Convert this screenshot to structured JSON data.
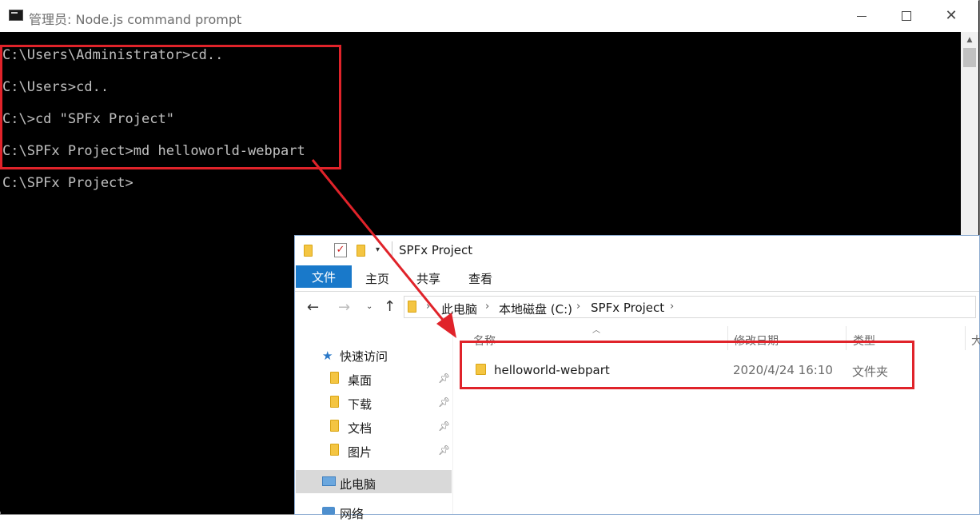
{
  "cmd": {
    "title": "管理员: Node.js command prompt",
    "lines": [
      "C:\\Users\\Administrator>cd..",
      "C:\\Users>cd..",
      "C:\\>cd \"SPFx Project\"",
      "C:\\SPFx Project>md helloworld-webpart",
      "C:\\SPFx Project>"
    ],
    "controls": {
      "minimize": "minimize-icon",
      "maximize": "maximize-icon",
      "close": "close-icon"
    }
  },
  "explorer": {
    "title": "SPFx Project",
    "ribbon_tabs": [
      "文件",
      "主页",
      "共享",
      "查看"
    ],
    "breadcrumb": [
      "此电脑",
      "本地磁盘 (C:)",
      "SPFx Project"
    ],
    "nav": {
      "quick_access": "快速访问",
      "items": [
        "桌面",
        "下载",
        "文档",
        "图片"
      ],
      "this_pc": "此电脑",
      "network": "网络"
    },
    "columns": [
      "名称",
      "修改日期",
      "类型",
      "大"
    ],
    "files": [
      {
        "name": "helloworld-webpart",
        "modified": "2020/4/24 16:10",
        "type": "文件夹"
      }
    ]
  },
  "annotations": {
    "highlight_color": "#e0232a"
  },
  "colors": {
    "ribbon_file_tab": "#1979ca",
    "console_bg": "#000000",
    "console_text": "#c0c0c0"
  }
}
